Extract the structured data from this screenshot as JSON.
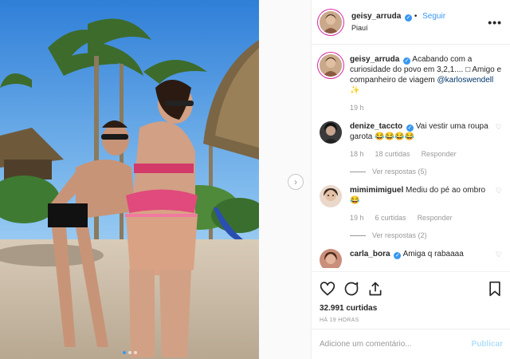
{
  "post": {
    "username": "geisy_arruda",
    "follow_label": "Seguir",
    "location": "Piauí",
    "more_label": "•••",
    "caption": "Acabando com a curiosidade do povo em 3,2,1.... □ Amigo e companheiro de viagem",
    "caption_mention": "@karloswendell",
    "caption_tail": " ✨",
    "caption_time": "19 h",
    "likes": "32.991 curtidas",
    "timestamp": "HÁ 19 HORAS"
  },
  "comments": [
    {
      "username": "denize_taccto",
      "text": "Vai vestir uma roupa garota 😂😂😂😂",
      "time": "18 h",
      "likes": "18 curtidas",
      "reply_label": "Responder",
      "replies_label": "Ver respostas (5)"
    },
    {
      "username": "mimimimiguel",
      "text": "Mediu do pé ao ombro 😂",
      "time": "19 h",
      "likes": "6 curtidas",
      "reply_label": "Responder",
      "replies_label": "Ver respostas (2)"
    },
    {
      "username": "carla_bora",
      "text": "Amiga q rabaaaa"
    }
  ],
  "add_comment": {
    "placeholder": "Adicione um comentário...",
    "publish_label": "Publicar"
  },
  "icons": {
    "verified": "verified-badge-icon",
    "next": "chevron-right-icon",
    "like": "heart-icon",
    "comment": "comment-icon",
    "share": "share-icon",
    "save": "bookmark-icon",
    "comment_like": "heart-small-icon"
  },
  "carousel": {
    "count": 3,
    "active_index": 1
  },
  "colors": {
    "accent": "#3897f0",
    "muted": "#999999",
    "publish_disabled": "#b2dffc"
  }
}
